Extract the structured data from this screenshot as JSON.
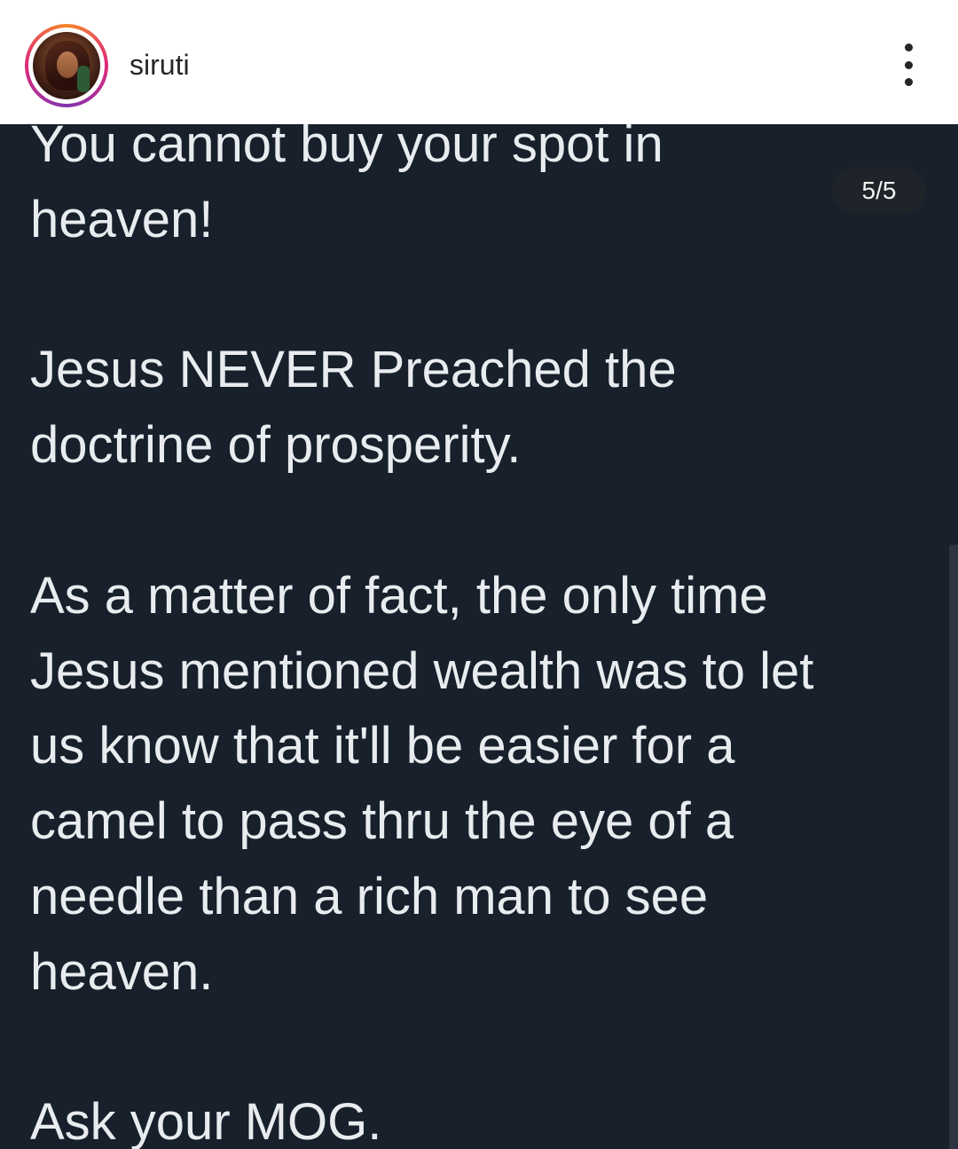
{
  "header": {
    "username": "siruti",
    "avatar_icon": "profile-avatar",
    "more_icon": "more-vertical-icon"
  },
  "post": {
    "counter": "5/5",
    "text": "You cannot buy your spot in\nheaven!\n\nJesus NEVER Preached the\ndoctrine of prosperity.\n\nAs a matter of fact, the only time\nJesus mentioned wealth was to let\nus know that it'll be easier for a\ncamel to pass thru the eye of a\nneedle than a rich man to see\nheaven.\n\nAsk your MOG."
  },
  "colors": {
    "header_bg": "#ffffff",
    "post_bg": "#17202b",
    "text": "#e9ecef",
    "counter_bg": "#1f232a"
  }
}
